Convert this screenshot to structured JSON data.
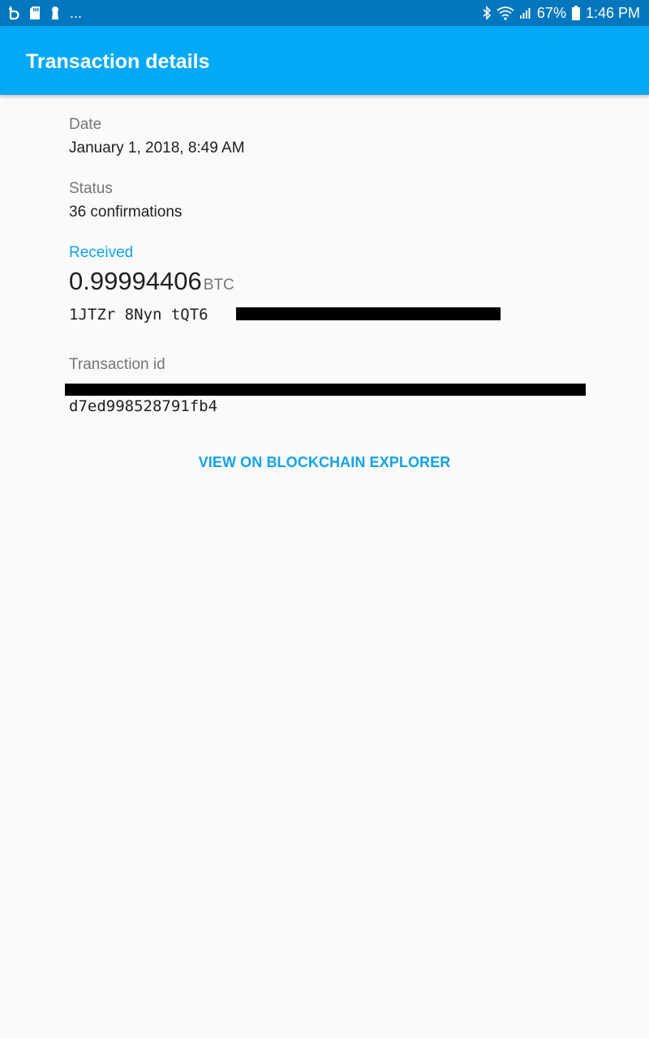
{
  "status_bar": {
    "left_icons": [
      "bitcoin-app-icon",
      "sd-card-icon",
      "keyhole-icon"
    ],
    "more": "...",
    "bluetooth_icon": "bluetooth-icon",
    "wifi_icon": "wifi-icon",
    "signal_icon": "signal-icon",
    "battery_percent": "67%",
    "battery_icon": "battery-icon",
    "time": "1:46 PM"
  },
  "app_bar": {
    "title": "Transaction details",
    "color": "#03a9f4"
  },
  "details": {
    "date_label": "Date",
    "date_value": "January 1, 2018, 8:49 AM",
    "status_label": "Status",
    "status_value": "36 confirmations",
    "direction_label": "Received",
    "amount": "0.99994406",
    "unit": "BTC",
    "address_visible": "1JTZr 8Nyn tQT6",
    "txid_label": "Transaction id",
    "txid_tail": "d7ed998528791fb4"
  },
  "actions": {
    "explorer_label": "VIEW ON BLOCKCHAIN EXPLORER"
  },
  "colors": {
    "accent": "#12a3e6",
    "status_bar": "#0277bd",
    "background": "#fafafa"
  }
}
